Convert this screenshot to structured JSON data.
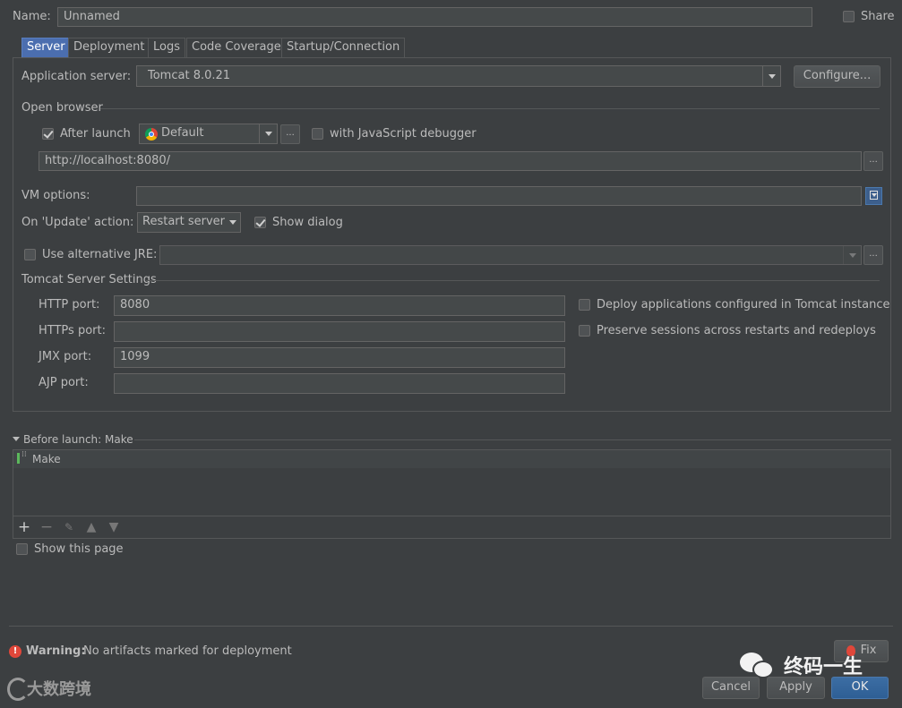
{
  "name_row": {
    "label": "Name:",
    "value": "Unnamed",
    "share_label": "Share"
  },
  "tabs": [
    {
      "label": "Server"
    },
    {
      "label": "Deployment"
    },
    {
      "label": "Logs"
    },
    {
      "label": "Code Coverage"
    },
    {
      "label": "Startup/Connection"
    }
  ],
  "server": {
    "app_server_label": "Application server:",
    "app_server_value": "Tomcat 8.0.21",
    "configure_label": "Configure...",
    "open_browser_title": "Open browser",
    "after_launch_label": "After launch",
    "browser_value": "Default",
    "ellipsis": "...",
    "js_debugger_label": "with JavaScript debugger",
    "url_value": "http://localhost:8080/",
    "vm_options_label": "VM options:",
    "vm_options_value": "",
    "update_action_label": "On 'Update' action:",
    "update_action_value": "Restart server",
    "show_dialog_label": "Show dialog",
    "alt_jre_label": "Use alternative JRE:",
    "alt_jre_value": "",
    "tomcat_settings_title": "Tomcat Server Settings",
    "http_port_label": "HTTP port:",
    "http_port_value": "8080",
    "https_port_label": "HTTPs port:",
    "https_port_value": "",
    "jmx_port_label": "JMX port:",
    "jmx_port_value": "1099",
    "ajp_port_label": "AJP port:",
    "ajp_port_value": "",
    "deploy_configured_label": "Deploy applications configured in Tomcat instance",
    "preserve_sessions_label": "Preserve sessions across restarts and redeploys"
  },
  "before_launch": {
    "title": "Before launch: Make",
    "items": [
      {
        "label": "Make"
      }
    ],
    "show_page_label": "Show this page"
  },
  "footer": {
    "warning_bold": "Warning:",
    "warning_text": "No artifacts marked for deployment",
    "fix_label": "Fix",
    "cancel_label": "Cancel",
    "apply_label": "Apply",
    "ok_label": "OK",
    "watermark_left": "大数跨境",
    "watermark_right": "终码一生"
  },
  "colors": {
    "accent": "#4b6eaf",
    "background": "#3c3f41",
    "warning": "#e0473a"
  },
  "checkbox_states": {
    "share": false,
    "after_launch": true,
    "js_debugger": false,
    "show_dialog": true,
    "alt_jre": false,
    "deploy_configured": false,
    "preserve_sessions": false,
    "show_page": false
  }
}
